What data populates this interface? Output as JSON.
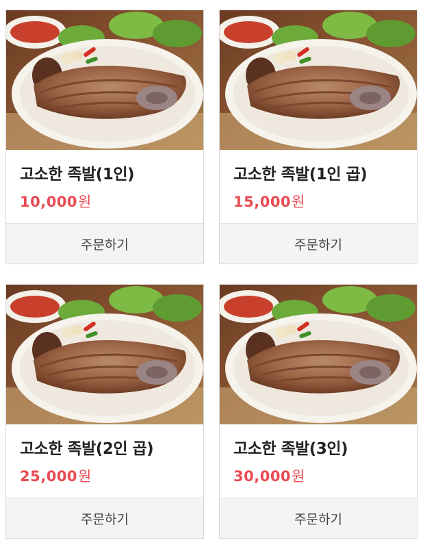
{
  "products": [
    {
      "name": "고소한 족발(1인)",
      "price": "10,000",
      "currency": "원",
      "order_label": "주문하기",
      "image": "jokbal-platter-photo"
    },
    {
      "name": "고소한 족발(1인 곱)",
      "price": "15,000",
      "currency": "원",
      "order_label": "주문하기",
      "image": "jokbal-platter-photo"
    },
    {
      "name": "고소한 족발(2인 곱)",
      "price": "25,000",
      "currency": "원",
      "order_label": "주문하기",
      "image": "jokbal-platter-photo"
    },
    {
      "name": "고소한 족발(3인)",
      "price": "30,000",
      "currency": "원",
      "order_label": "주문하기",
      "image": "jokbal-platter-photo"
    }
  ],
  "colors": {
    "price": "#e94b52",
    "button_bg": "#f3f4f6",
    "border": "#d8d8d8"
  }
}
